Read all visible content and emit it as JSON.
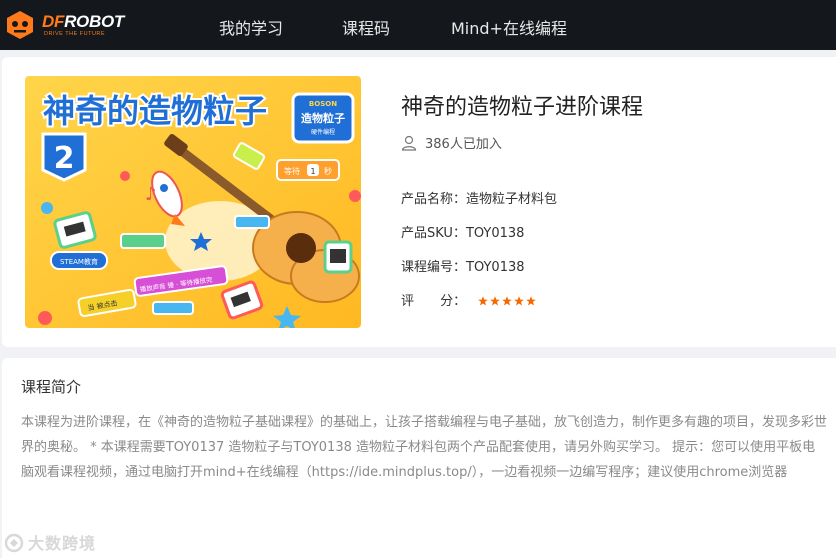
{
  "header": {
    "logo_text_a": "DF",
    "logo_text_b": "ROBOT",
    "logo_tag": "DRIVE THE FUTURE",
    "nav": [
      {
        "label": "我的学习"
      },
      {
        "label": "课程码"
      },
      {
        "label": "Mind+在线编程"
      }
    ]
  },
  "course": {
    "title": "神奇的造物粒子进阶课程",
    "joined": "386人已加入",
    "product_name_label": "产品名称：",
    "product_name": "造物粒子材料包",
    "sku_label": "产品SKU：",
    "sku": "TOY0138",
    "code_label": "课程编号：",
    "code": "TOY0138",
    "rating_label": "评 分：",
    "rating": 5,
    "rating_max": 5,
    "star_color": "#f56a00"
  },
  "cover": {
    "title": "神奇的造物粒子",
    "level": "2",
    "badge_brand": "BOSON",
    "badge_title": "造物粒子",
    "badge_sub": "硬件编程",
    "wait_pre": "等待",
    "wait_num": "1",
    "wait_post": "秒",
    "steam": "STEAM教育",
    "play_sound": "播放声音 锤 · 等待播放完",
    "when_click": "当 被点击"
  },
  "intro": {
    "title": "课程简介",
    "text": "本课程为进阶课程，在《神奇的造物粒子基础课程》的基础上，让孩子搭载编程与电子基础，放飞创造力，制作更多有趣的项目，发现多彩世界的奥秘。 * 本课程需要TOY0137 造物粒子与TOY0138 造物粒子材料包两个产品配套使用，请另外购买学习。 提示：您可以使用平板电脑观看课程视频，通过电脑打开mind+在线编程（https://ide.mindplus.top/），一边看视频一边编写程序；建议使用chrome浏览器"
  },
  "watermark": {
    "text": "大数跨境"
  },
  "colors": {
    "header_bg": "#14171c",
    "brand_orange": "#ff7a1a",
    "cover_yellow": "#ffc93c",
    "cover_blue": "#1f6fd6"
  }
}
